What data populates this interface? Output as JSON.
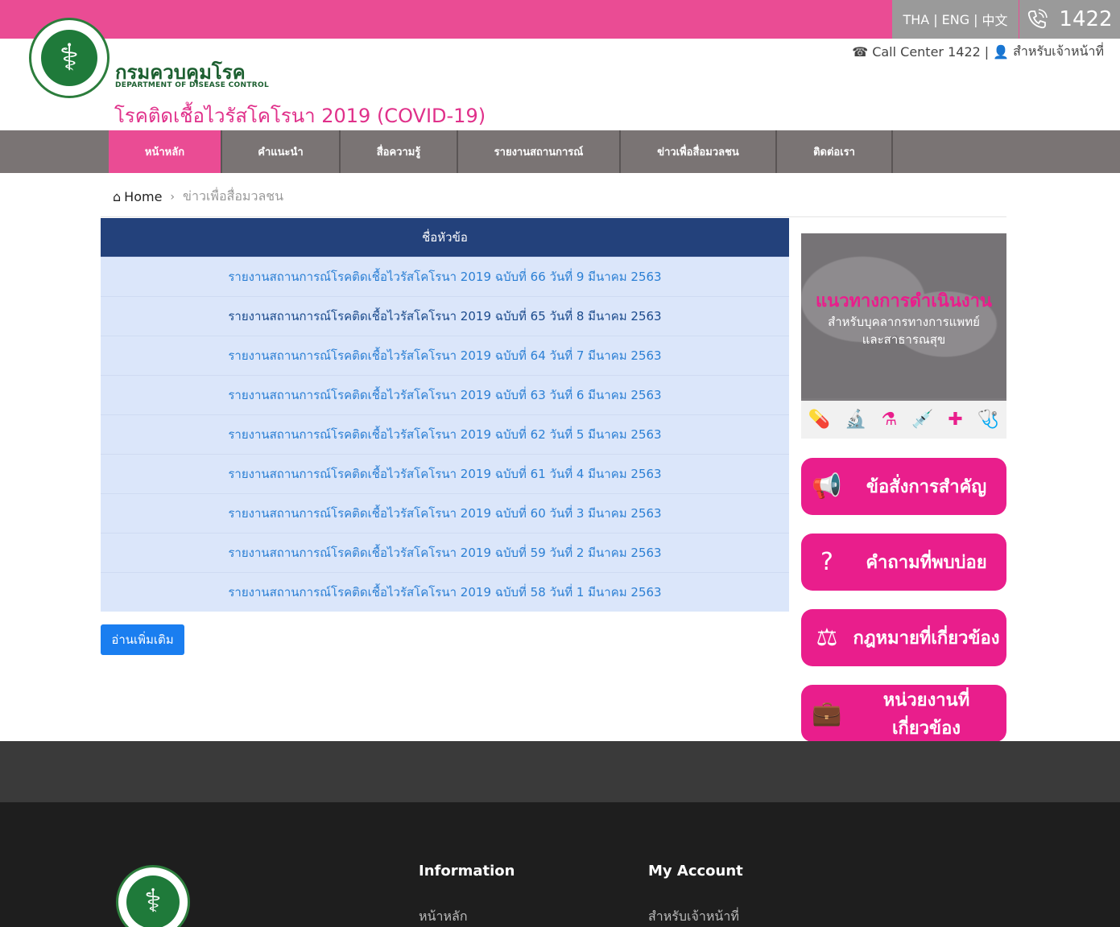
{
  "topbar": {
    "languages": [
      "THA",
      "ENG",
      "中文"
    ],
    "hotline": "1422",
    "colors": {
      "pink": "#ea4c94",
      "grey": "#9a9a9a"
    }
  },
  "header": {
    "dept_name_th": "กรมควบคุมโรค",
    "dept_name_en": "DEPARTMENT OF DISEASE CONTROL",
    "site_title": "โรคติดเชื้อไวรัสโคโรนา 2019 (COVID-19)",
    "call_center": "Call Center 1422",
    "divider": "|",
    "staff_link": "สำหรับเจ้าหน้าที่"
  },
  "nav": {
    "items": [
      {
        "label": "หน้าหลัก",
        "active": true
      },
      {
        "label": "คำแนะนำ",
        "active": false
      },
      {
        "label": "สื่อความรู้",
        "active": false
      },
      {
        "label": "รายงานสถานการณ์",
        "active": false
      },
      {
        "label": "ข่าวเพื่อสื่อมวลชน",
        "active": false
      },
      {
        "label": "ติดต่อเรา",
        "active": false
      }
    ]
  },
  "breadcrumb": {
    "home": "Home",
    "current": "ข่าวเพื่อสื่อมวลชน"
  },
  "table": {
    "header": "ชื่อหัวข้อ",
    "rows": [
      "รายงานสถานการณ์โรคติดเชื้อไวรัสโคโรนา 2019 ฉบับที่ 66 วันที่ 9 มีนาคม 2563",
      "รายงานสถานการณ์โรคติดเชื้อไวรัสโคโรนา 2019 ฉบับที่ 65 วันที่ 8 มีนาคม 2563",
      "รายงานสถานการณ์โรคติดเชื้อไวรัสโคโรนา 2019 ฉบับที่ 64 วันที่ 7 มีนาคม 2563",
      "รายงานสถานการณ์โรคติดเชื้อไวรัสโคโรนา 2019 ฉบับที่ 63 วันที่ 6 มีนาคม 2563",
      "รายงานสถานการณ์โรคติดเชื้อไวรัสโคโรนา 2019 ฉบับที่ 62 วันที่ 5 มีนาคม 2563",
      "รายงานสถานการณ์โรคติดเชื้อไวรัสโคโรนา 2019 ฉบับที่ 61 วันที่ 4 มีนาคม 2563",
      "รายงานสถานการณ์โรคติดเชื้อไวรัสโคโรนา 2019 ฉบับที่ 60 วันที่ 3 มีนาคม 2563",
      "รายงานสถานการณ์โรคติดเชื้อไวรัสโคโรนา 2019 ฉบับที่ 59 วันที่ 2 มีนาคม 2563",
      "รายงานสถานการณ์โรคติดเชื้อไวรัสโคโรนา 2019 ฉบับที่ 58 วันที่ 1 มีนาคม 2563"
    ],
    "more_button": "อ่านเพิ่มเติม"
  },
  "sidebar": {
    "banner": {
      "title": "แนวทางการดำเนินงาน",
      "subtitle_1": "สำหรับบุคลากรทางการแพทย์",
      "subtitle_2": "และสาธารณสุข"
    },
    "buttons": [
      {
        "label": "ข้อสั่งการสำคัญ",
        "icon": "announcement-icon"
      },
      {
        "label": "คำถามที่พบบ่อย",
        "icon": "question-icon"
      },
      {
        "label": "กฎหมายที่เกี่ยวข้อง",
        "icon": "scales-icon"
      },
      {
        "label": "หน่วยงานที่เกี่ยวข้อง",
        "icon": "briefcase-icon"
      }
    ]
  },
  "footer": {
    "information_heading": "Information",
    "information_link": "หน้าหลัก",
    "account_heading": "My Account",
    "account_link": "สำหรับเจ้าหน้าที่"
  }
}
